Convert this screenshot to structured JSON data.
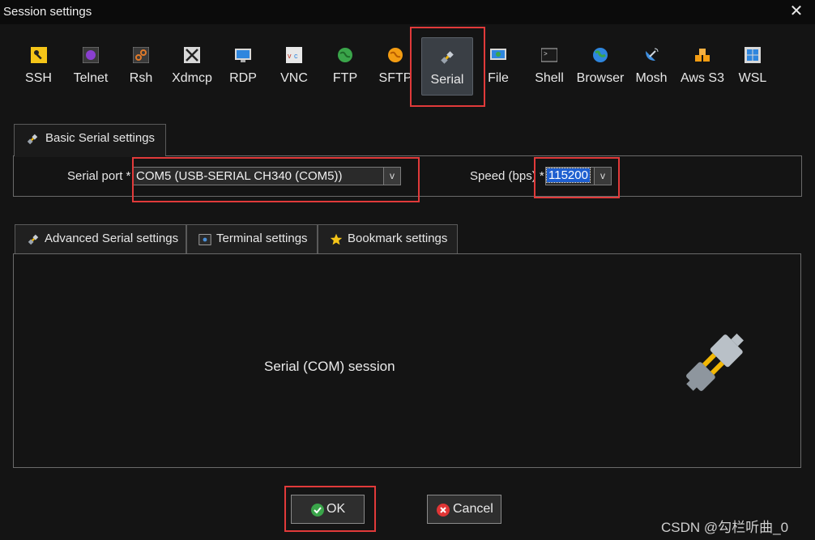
{
  "window": {
    "title": "Session settings",
    "close_icon": "close-icon"
  },
  "session_types": [
    {
      "key": "ssh",
      "label": "SSH",
      "icon": "key-icon"
    },
    {
      "key": "telnet",
      "label": "Telnet",
      "icon": "telnet-icon"
    },
    {
      "key": "rsh",
      "label": "Rsh",
      "icon": "rsh-icon"
    },
    {
      "key": "xdmcp",
      "label": "Xdmcp",
      "icon": "x-display-icon"
    },
    {
      "key": "rdp",
      "label": "RDP",
      "icon": "rdp-monitor-icon"
    },
    {
      "key": "vnc",
      "label": "VNC",
      "icon": "vnc-icon"
    },
    {
      "key": "ftp",
      "label": "FTP",
      "icon": "ftp-globe-icon"
    },
    {
      "key": "sftp",
      "label": "SFTP",
      "icon": "sftp-globe-icon"
    },
    {
      "key": "serial",
      "label": "Serial",
      "icon": "serial-plug-icon",
      "selected": true
    },
    {
      "key": "file",
      "label": "File",
      "icon": "file-monitor-icon"
    },
    {
      "key": "shell",
      "label": "Shell",
      "icon": "terminal-icon"
    },
    {
      "key": "browser",
      "label": "Browser",
      "icon": "globe-icon"
    },
    {
      "key": "mosh",
      "label": "Mosh",
      "icon": "satellite-dish-icon"
    },
    {
      "key": "awss3",
      "label": "Aws S3",
      "icon": "aws-cubes-icon"
    },
    {
      "key": "wsl",
      "label": "WSL",
      "icon": "windows-logo-icon"
    }
  ],
  "basic": {
    "tab_label": "Basic Serial settings",
    "serial_port_label": "Serial port *",
    "serial_port_value": "COM5  (USB-SERIAL CH340 (COM5))",
    "speed_label": "Speed (bps) *",
    "speed_value": "115200",
    "dropdown_arrow": "v"
  },
  "tabs": [
    {
      "label": "Advanced Serial settings",
      "icon": "serial-plug-icon"
    },
    {
      "label": "Terminal settings",
      "icon": "terminal-settings-icon"
    },
    {
      "label": "Bookmark settings",
      "icon": "star-icon"
    }
  ],
  "content": {
    "session_label": "Serial (COM) session",
    "big_icon": "serial-plug-large-icon"
  },
  "buttons": {
    "ok": "OK",
    "cancel": "Cancel"
  },
  "watermark": "CSDN @勾栏听曲_0",
  "colors": {
    "highlight_red": "#e13a3a",
    "selection_blue": "#1e5fd0",
    "ok_green": "#3aa54a",
    "cancel_red": "#e03535",
    "plug_yellow": "#f2b705"
  }
}
